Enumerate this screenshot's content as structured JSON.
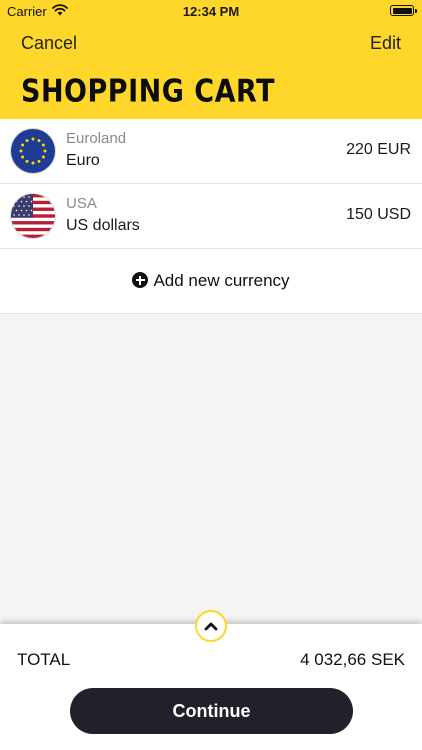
{
  "status_bar": {
    "carrier": "Carrier",
    "time": "12:34 PM"
  },
  "nav": {
    "cancel_label": "Cancel",
    "edit_label": "Edit",
    "title": "SHOPPING CART"
  },
  "currencies": [
    {
      "region": "Euroland",
      "currency": "Euro",
      "amount": "220 EUR",
      "flag_icon": "eu-flag-icon"
    },
    {
      "region": "USA",
      "currency": "US dollars",
      "amount": "150 USD",
      "flag_icon": "us-flag-icon"
    }
  ],
  "add_currency": {
    "label": "Add new currency",
    "icon": "plus-circle-icon"
  },
  "footer": {
    "expand_icon": "chevron-up-icon",
    "total_label": "TOTAL",
    "total_value": "4 032,66 SEK",
    "continue_label": "Continue"
  },
  "colors": {
    "accent": "#ffd72a",
    "button_dark": "#22202a",
    "eu_blue": "#1f3c94",
    "us_red": "#b22234"
  }
}
